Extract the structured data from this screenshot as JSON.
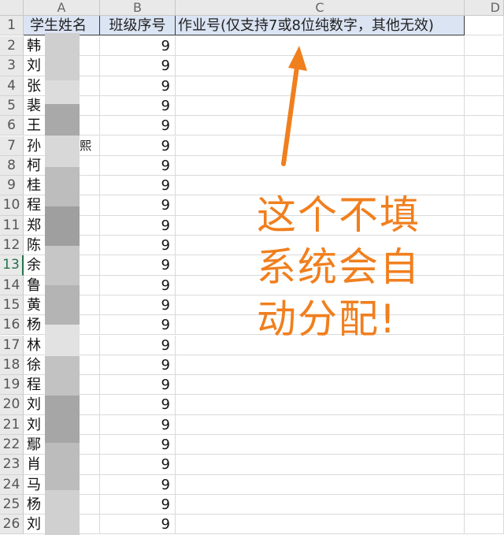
{
  "columns": [
    "A",
    "B",
    "C",
    "D"
  ],
  "header": {
    "row_number": "1",
    "student_name": "学生姓名",
    "class_seat_no": "班级序号",
    "homework_no": "作业号(仅支持7或8位纯数字，其他无效)"
  },
  "rows": [
    {
      "num": "2",
      "name": "韩",
      "cls": "9"
    },
    {
      "num": "3",
      "name": "刘",
      "cls": "9"
    },
    {
      "num": "4",
      "name": "张",
      "cls": "9"
    },
    {
      "num": "5",
      "name": "裴",
      "cls": "9"
    },
    {
      "num": "6",
      "name": "王",
      "cls": "9"
    },
    {
      "num": "7",
      "name": "孙",
      "cls": "9",
      "suffix": "熙"
    },
    {
      "num": "8",
      "name": "柯",
      "cls": "9"
    },
    {
      "num": "9",
      "name": "桂",
      "cls": "9"
    },
    {
      "num": "10",
      "name": "程",
      "cls": "9"
    },
    {
      "num": "11",
      "name": "郑",
      "cls": "9"
    },
    {
      "num": "12",
      "name": "陈",
      "cls": "9"
    },
    {
      "num": "13",
      "name": "余",
      "cls": "9",
      "active": true
    },
    {
      "num": "14",
      "name": "鲁",
      "cls": "9"
    },
    {
      "num": "15",
      "name": "黄",
      "cls": "9"
    },
    {
      "num": "16",
      "name": "杨",
      "cls": "9"
    },
    {
      "num": "17",
      "name": "林",
      "cls": "9"
    },
    {
      "num": "18",
      "name": "徐",
      "cls": "9"
    },
    {
      "num": "19",
      "name": "程",
      "cls": "9"
    },
    {
      "num": "20",
      "name": "刘",
      "cls": "9"
    },
    {
      "num": "21",
      "name": "刘",
      "cls": "9"
    },
    {
      "num": "22",
      "name": "鄢",
      "cls": "9"
    },
    {
      "num": "23",
      "name": "肖",
      "cls": "9"
    },
    {
      "num": "24",
      "name": "马",
      "cls": "9"
    },
    {
      "num": "25",
      "name": "杨",
      "cls": "9"
    },
    {
      "num": "26",
      "name": "刘",
      "cls": "9"
    }
  ],
  "annotation": {
    "line1": "这个不填",
    "line2": "系统会自",
    "line3": "动分配!",
    "color": "#f07f1e"
  }
}
